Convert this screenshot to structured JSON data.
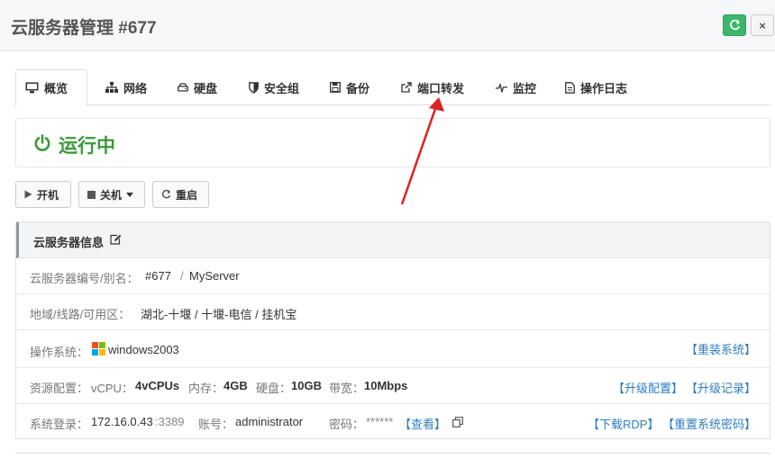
{
  "header": {
    "title": "云服务器管理 #677",
    "refresh_icon": "refresh-icon",
    "close_label": "×"
  },
  "tabs": [
    {
      "label": "概览",
      "icon": "desktop-icon",
      "active": true
    },
    {
      "label": "网络",
      "icon": "sitemap-icon",
      "active": false
    },
    {
      "label": "硬盘",
      "icon": "hdd-icon",
      "active": false
    },
    {
      "label": "安全组",
      "icon": "shield-icon",
      "active": false
    },
    {
      "label": "备份",
      "icon": "save-icon",
      "active": false
    },
    {
      "label": "端口转发",
      "icon": "external-link-icon",
      "active": false
    },
    {
      "label": "监控",
      "icon": "heartbeat-icon",
      "active": false
    },
    {
      "label": "操作日志",
      "icon": "file-text-icon",
      "active": false
    }
  ],
  "status": {
    "text": "运行中",
    "color": "#3a9a3a"
  },
  "actions": {
    "start": "开机",
    "shutdown": "关机",
    "restart": "重启"
  },
  "panel": {
    "title": "云服务器信息",
    "id_row": {
      "label": "云服务器编号/别名：",
      "id": "#677",
      "sep": "/",
      "alias": "MyServer"
    },
    "region_row": {
      "label": "地域/线路/可用区：",
      "value": "湖北-十堰 / 十堰-电信 / 挂机宝"
    },
    "os_row": {
      "label": "操作系统：",
      "os": "windows2003",
      "reinstall": "【重装系统】"
    },
    "spec_row": {
      "label": "资源配置：",
      "vcpu_label": "vCPU：",
      "vcpu": "4vCPUs",
      "mem_label": "内存：",
      "mem": "4GB",
      "disk_label": "硬盘：",
      "disk": "10GB",
      "bw_label": "带宽：",
      "bw": "10Mbps",
      "upgrade": "【升级配置】",
      "upgrade_log": "【升级记录】"
    },
    "login_row": {
      "label": "系统登录：",
      "ip": "172.16.0.43",
      "port": ":3389",
      "account_label": "账号：",
      "account": "administrator",
      "password_label": "密码：",
      "password": "******",
      "view": "【查看】",
      "download_rdp": "【下载RDP】",
      "reset_password": "【重置系统密码】"
    }
  },
  "colors": {
    "accent_green": "#3bb76a",
    "link": "#2f7dc0",
    "arrow": "#e02020"
  }
}
